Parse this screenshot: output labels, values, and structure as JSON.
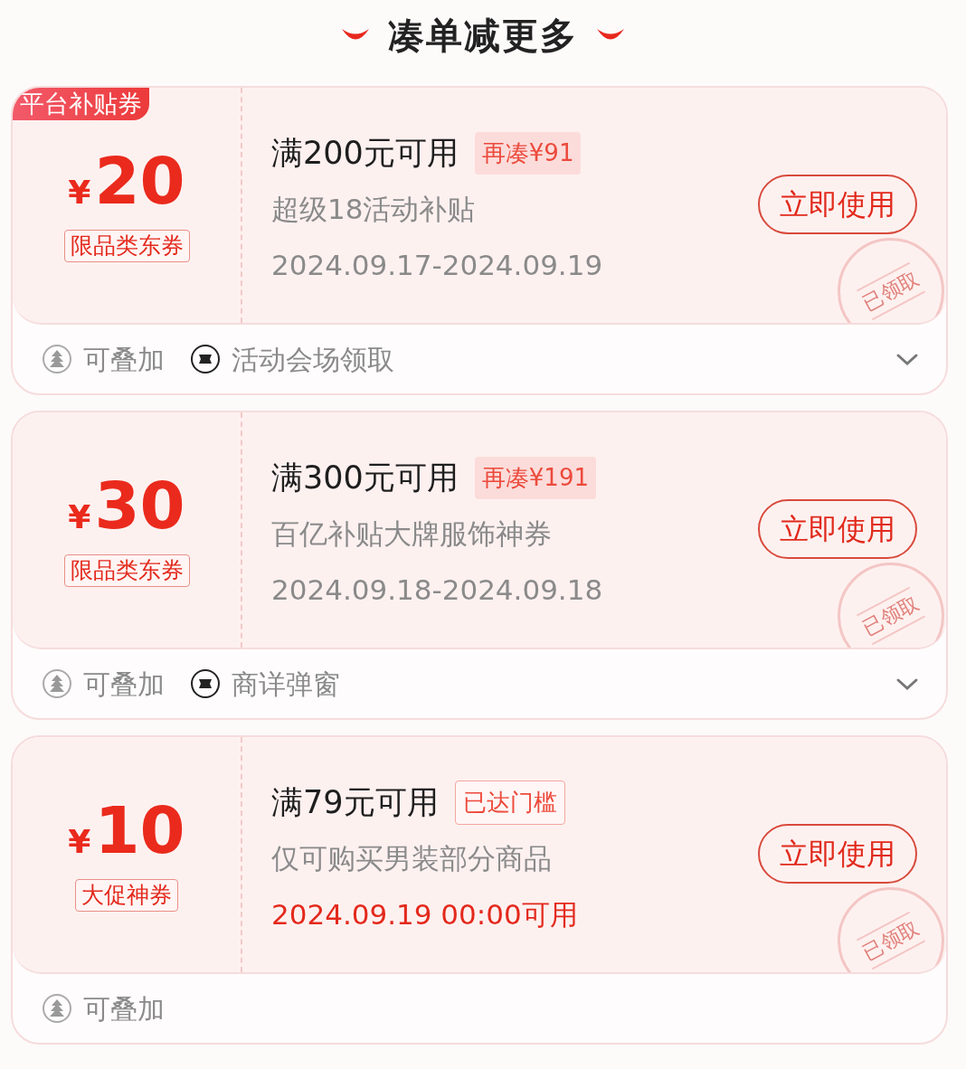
{
  "header": {
    "title": "凑单减更多"
  },
  "coupons": [
    {
      "corner_tag": "平台补贴券",
      "currency": "¥",
      "amount": "20",
      "tag": "限品类东券",
      "condition": "满200元可用",
      "badge": "再凑¥91",
      "threshold_met": false,
      "description": "超级18活动补贴",
      "date": "2024.09.17-2024.09.19",
      "upcoming": false,
      "button": "立即使用",
      "stamp": "已领取",
      "footer": [
        {
          "kind": "stack",
          "label": "可叠加"
        },
        {
          "kind": "source",
          "label": "活动会场领取"
        }
      ],
      "expandable": true
    },
    {
      "currency": "¥",
      "amount": "30",
      "tag": "限品类东券",
      "condition": "满300元可用",
      "badge": "再凑¥191",
      "threshold_met": false,
      "description": "百亿补贴大牌服饰神券",
      "date": "2024.09.18-2024.09.18",
      "upcoming": false,
      "button": "立即使用",
      "stamp": "已领取",
      "footer": [
        {
          "kind": "stack",
          "label": "可叠加"
        },
        {
          "kind": "source",
          "label": "商详弹窗"
        }
      ],
      "expandable": true
    },
    {
      "currency": "¥",
      "amount": "10",
      "tag": "大促神券",
      "condition": "满79元可用",
      "badge": "已达门槛",
      "threshold_met": true,
      "description": "仅可购买男装部分商品",
      "date": "2024.09.19 00:00可用",
      "upcoming": true,
      "button": "立即使用",
      "stamp": "已领取",
      "footer": [
        {
          "kind": "stack",
          "label": "可叠加"
        }
      ],
      "expandable": false
    }
  ]
}
